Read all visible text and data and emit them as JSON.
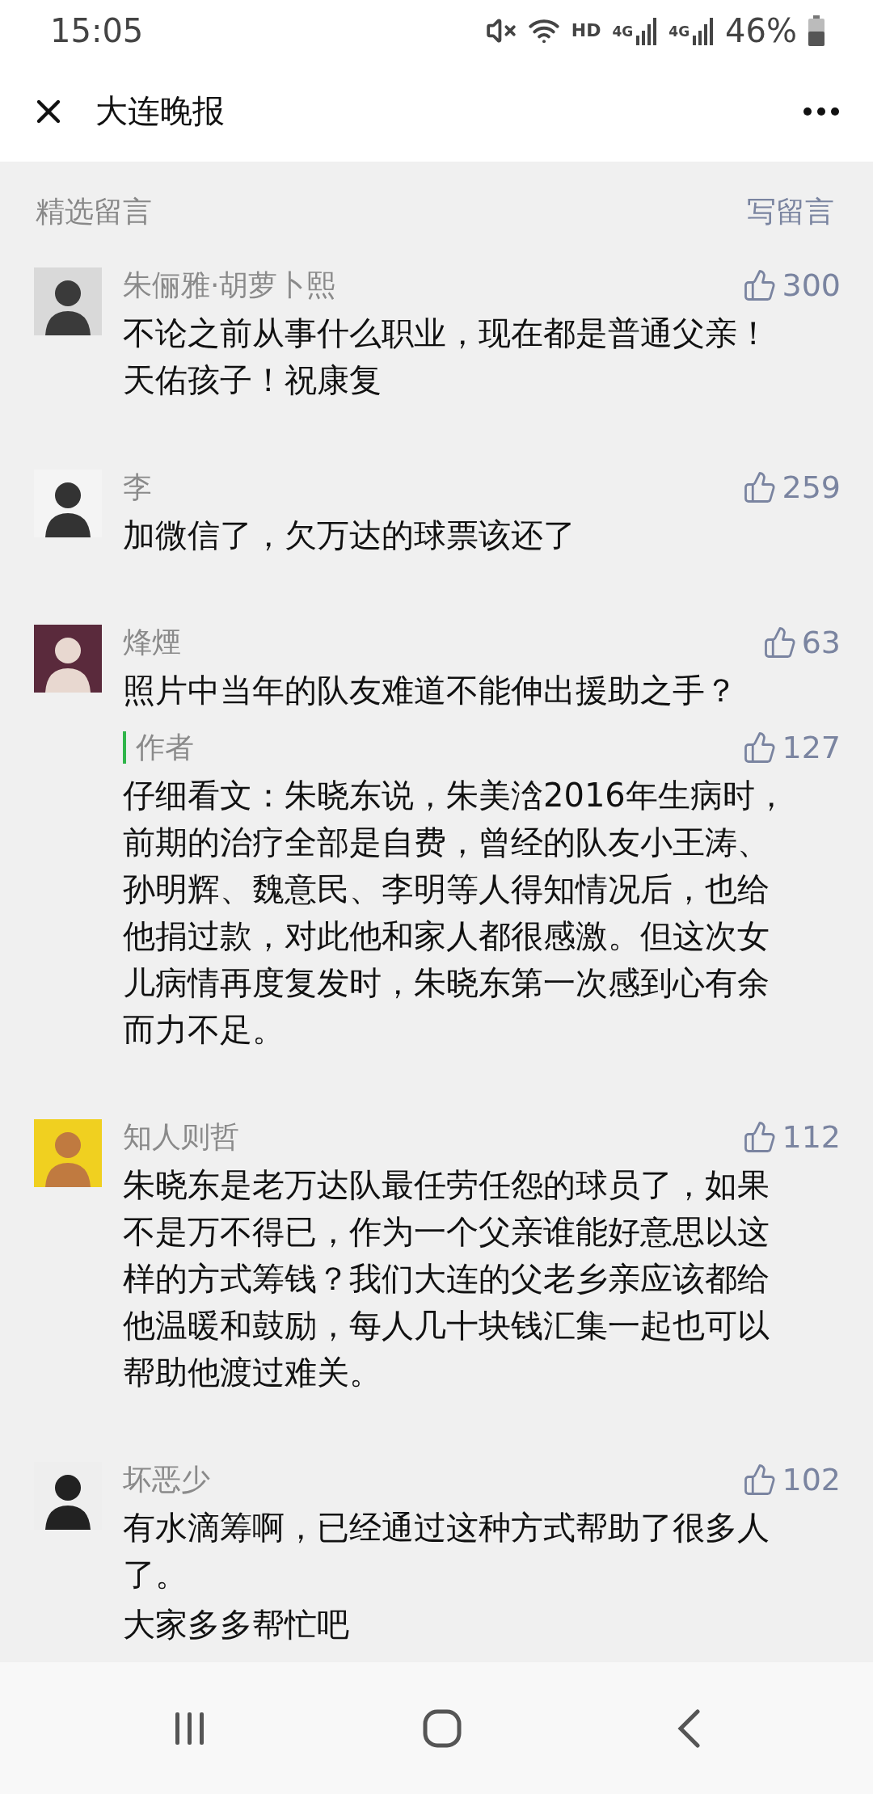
{
  "status_bar": {
    "time": "15:05",
    "hd": "HD",
    "networks": [
      "4G",
      "4G"
    ],
    "battery": "46%"
  },
  "header": {
    "title": "大连晚报"
  },
  "section": {
    "title": "精选留言",
    "action": "写留言"
  },
  "comments": [
    {
      "name": "朱俪雅·胡萝卜熙",
      "likes": "300",
      "text": "不论之前从事什么职业，现在都是普通父亲！天佑孩子！祝康复"
    },
    {
      "name": "李",
      "likes": "259",
      "text": "加微信了，欠万达的球票该还了"
    },
    {
      "name": "烽煙",
      "likes": "63",
      "text": "照片中当年的队友难道不能伸出援助之手？",
      "replies": [
        {
          "author": "作者",
          "likes": "127",
          "text": "仔细看文：朱晓东说，朱美浛2016年生病时，前期的治疗全部是自费，曾经的队友小王涛、孙明辉、魏意民、李明等人得知情况后，也给他捐过款，对此他和家人都很感激。但这次女儿病情再度复发时，朱晓东第一次感到心有余而力不足。"
        }
      ]
    },
    {
      "name": "知人则哲",
      "likes": "112",
      "text": "朱晓东是老万达队最任劳任怨的球员了，如果不是万不得已，作为一个父亲谁能好意思以这样的方式筹钱？我们大连的父老乡亲应该都给他温暖和鼓励，每人几十块钱汇集一起也可以帮助他渡过难关。"
    },
    {
      "name": "坏恶少",
      "likes": "102",
      "text": "有水滴筹啊，已经通过这种方式帮助了很多人了。",
      "more_text": "大家多多帮忙吧"
    }
  ]
}
